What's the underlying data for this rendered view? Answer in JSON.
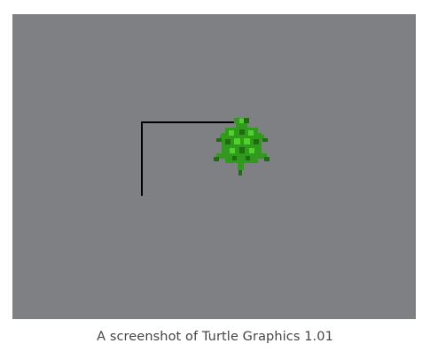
{
  "caption": "A screenshot of Turtle Graphics 1.01",
  "colors": {
    "canvas_background": "#7e8083",
    "pen": "#000000",
    "turtle_dark": "#1e6b10",
    "turtle_mid": "#2f9a1c",
    "turtle_light": "#4fd22a",
    "caption_text": "#444444"
  },
  "turtle": {
    "icon": "turtle-icon",
    "heading": "up"
  },
  "icons": {
    "pen_trail": "pen-trail-line"
  }
}
